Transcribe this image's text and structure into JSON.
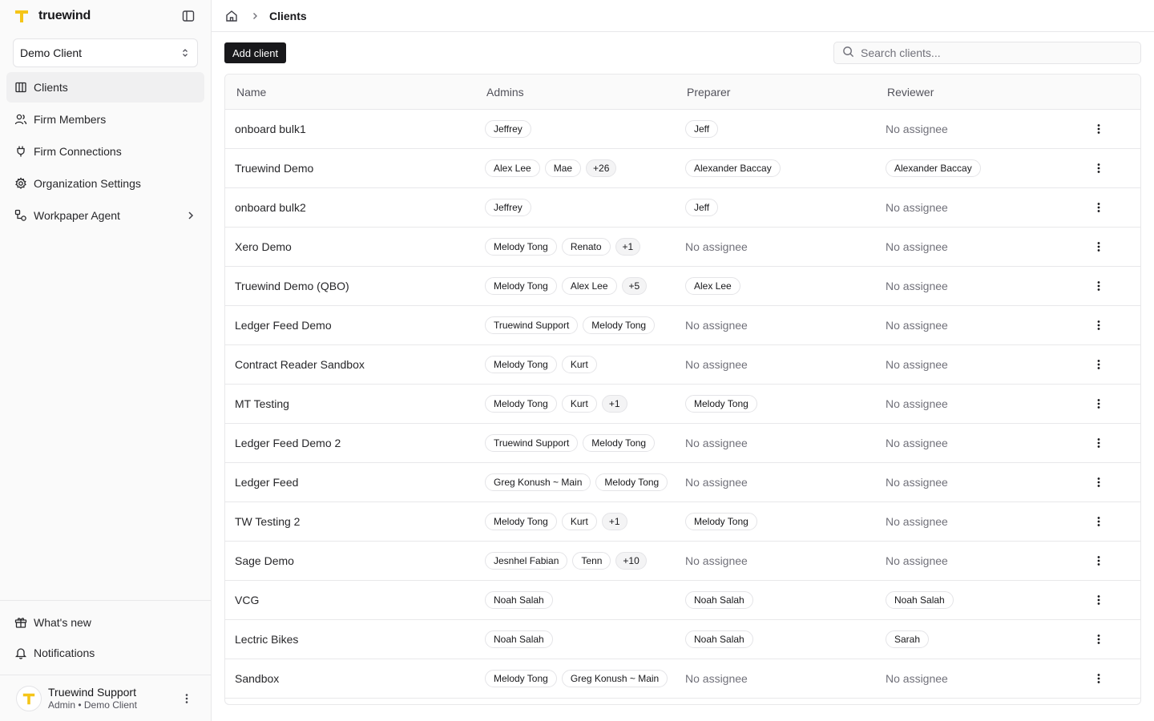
{
  "brand": {
    "name": "truewind",
    "accent": "#f5c518"
  },
  "client_selector": {
    "value": "Demo Client"
  },
  "nav": [
    {
      "label": "Clients",
      "icon": "building-icon",
      "active": true
    },
    {
      "label": "Firm Members",
      "icon": "users-icon"
    },
    {
      "label": "Firm Connections",
      "icon": "plug-icon"
    },
    {
      "label": "Organization Settings",
      "icon": "gear-icon"
    },
    {
      "label": "Workpaper Agent",
      "icon": "workflow-icon",
      "has_submenu": true
    }
  ],
  "bottom_links": [
    {
      "label": "What's new",
      "icon": "gift-icon"
    },
    {
      "label": "Notifications",
      "icon": "bell-icon"
    }
  ],
  "user": {
    "name": "Truewind Support",
    "role": "Admin • Demo Client"
  },
  "breadcrumb": {
    "current": "Clients"
  },
  "toolbar": {
    "add_label": "Add client",
    "search_placeholder": "Search clients..."
  },
  "table": {
    "columns": {
      "name": "Name",
      "admins": "Admins",
      "preparer": "Preparer",
      "reviewer": "Reviewer"
    },
    "no_assignee": "No assignee",
    "rows": [
      {
        "name": "onboard bulk1",
        "admins": [
          "Jeffrey"
        ],
        "admins_more": "",
        "preparer": "Jeff",
        "reviewer": ""
      },
      {
        "name": "Truewind Demo",
        "admins": [
          "Alex Lee",
          "Mae"
        ],
        "admins_more": "+26",
        "preparer": "Alexander Baccay",
        "reviewer": "Alexander Baccay"
      },
      {
        "name": "onboard bulk2",
        "admins": [
          "Jeffrey"
        ],
        "admins_more": "",
        "preparer": "Jeff",
        "reviewer": ""
      },
      {
        "name": "Xero Demo",
        "admins": [
          "Melody Tong",
          "Renato"
        ],
        "admins_more": "+1",
        "preparer": "",
        "reviewer": ""
      },
      {
        "name": "Truewind Demo (QBO)",
        "admins": [
          "Melody Tong",
          "Alex Lee"
        ],
        "admins_more": "+5",
        "preparer": "Alex Lee",
        "reviewer": ""
      },
      {
        "name": "Ledger Feed Demo",
        "admins": [
          "Truewind Support",
          "Melody Tong"
        ],
        "admins_more": "",
        "preparer": "",
        "reviewer": ""
      },
      {
        "name": "Contract Reader Sandbox",
        "admins": [
          "Melody Tong",
          "Kurt"
        ],
        "admins_more": "",
        "preparer": "",
        "reviewer": ""
      },
      {
        "name": "MT Testing",
        "admins": [
          "Melody Tong",
          "Kurt"
        ],
        "admins_more": "+1",
        "preparer": "Melody Tong",
        "reviewer": ""
      },
      {
        "name": "Ledger Feed Demo 2",
        "admins": [
          "Truewind Support",
          "Melody Tong"
        ],
        "admins_more": "",
        "preparer": "",
        "reviewer": ""
      },
      {
        "name": "Ledger Feed",
        "admins": [
          "Greg Konush ~ Main",
          "Melody Tong"
        ],
        "admins_more": "",
        "preparer": "",
        "reviewer": ""
      },
      {
        "name": "TW Testing 2",
        "admins": [
          "Melody Tong",
          "Kurt"
        ],
        "admins_more": "+1",
        "preparer": "Melody Tong",
        "reviewer": ""
      },
      {
        "name": "Sage Demo",
        "admins": [
          "Jesnhel Fabian",
          "Tenn"
        ],
        "admins_more": "+10",
        "preparer": "",
        "reviewer": ""
      },
      {
        "name": "VCG",
        "admins": [
          "Noah Salah"
        ],
        "admins_more": "",
        "preparer": "Noah Salah",
        "reviewer": "Noah Salah"
      },
      {
        "name": "Lectric Bikes",
        "admins": [
          "Noah Salah"
        ],
        "admins_more": "",
        "preparer": "Noah Salah",
        "reviewer": "Sarah"
      },
      {
        "name": "Sandbox",
        "admins": [
          "Melody Tong",
          "Greg Konush ~ Main"
        ],
        "admins_more": "",
        "preparer": "",
        "reviewer": ""
      }
    ]
  }
}
